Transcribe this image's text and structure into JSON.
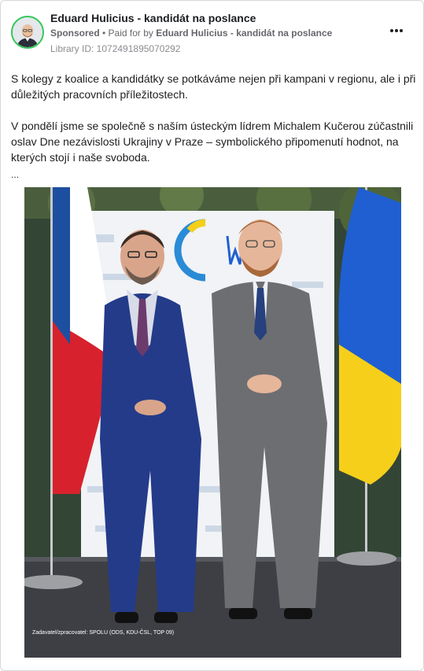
{
  "post": {
    "author": "Eduard Hulicius - kandidát na poslance",
    "sponsored_label": "Sponsored",
    "paid_for_prefix": " • Paid for by ",
    "payer": "Eduard Hulicius - kandidát na poslance",
    "library_id": "Library ID: 1072491895070292",
    "paragraph_1": "S kolegy z koalice a kandidátky se potkáváme nejen při kampani v regionu, ale i při důležitých pracovních příležitostech.",
    "paragraph_2": "V pondělí jsme se společně s naším ústeckým lídrem Michalem Kučerou zúčastnili oslav Dne nezávislosti Ukrajiny v Praze – symbolického připomenutí hodnot, na kterých stojí i naše svoboda.",
    "ellipsis": "...",
    "more_icon": "more-horizontal-icon"
  },
  "photo": {
    "caption": "Zadavatel/zpracovatel: SPOLU (ODS, KDU-ČSL, TOP 09)",
    "flag_left": "czech-flag",
    "flag_right": "ukrainian-flag",
    "colors": {
      "ukraine_blue": "#1f5fd1",
      "ukraine_yellow": "#f5cf1a",
      "czech_red": "#d7222d",
      "czech_blue": "#1d4fa0",
      "suit_blue": "#243b8a",
      "suit_grey": "#6d6e72"
    }
  }
}
